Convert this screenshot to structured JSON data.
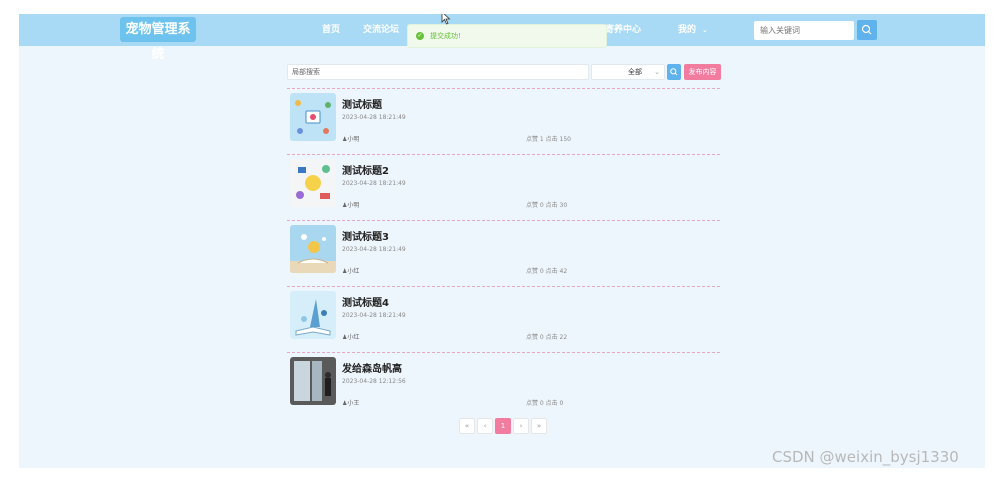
{
  "header": {
    "logo": "宠物管理系统",
    "nav": [
      "首页",
      "交流论坛",
      "寄养中心",
      "我的"
    ],
    "search_placeholder": "输入关键词"
  },
  "toast": {
    "message": "提交成功!"
  },
  "toolbar": {
    "search_placeholder": "局部搜索",
    "category": "全部",
    "publish_label": "发布内容"
  },
  "posts": [
    {
      "title": "测试标题",
      "date": "2023-04-28 18:21:49",
      "author": "♟小明",
      "stats": "点赞 1 点击 150"
    },
    {
      "title": "测试标题2",
      "date": "2023-04-28 18:21:49",
      "author": "♟小明",
      "stats": "点赞 0 点击 30"
    },
    {
      "title": "测试标题3",
      "date": "2023-04-28 18:21:49",
      "author": "♟小红",
      "stats": "点赞 0 点击 42"
    },
    {
      "title": "测试标题4",
      "date": "2023-04-28 18:21:49",
      "author": "♟小红",
      "stats": "点赞 0 点击 22"
    },
    {
      "title": "发给森岛帆高",
      "date": "2023-04-28 12:12:56",
      "author": "♟小王",
      "stats": "点赞 0 点击 0"
    }
  ],
  "pagination": [
    "«",
    "‹",
    "1",
    "›",
    "»"
  ],
  "watermark": "CSDN @weixin_bysj1330"
}
